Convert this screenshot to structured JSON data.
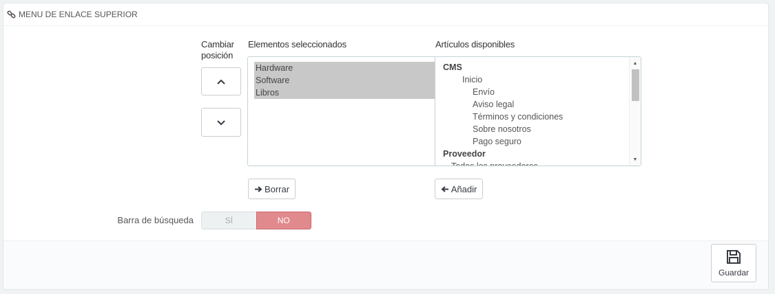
{
  "panel": {
    "title": "MENU DE ENLACE SUPERIOR",
    "title_icon": "link-icon"
  },
  "position": {
    "label_line1": "Cambiar",
    "label_line2": "posición",
    "up_icon": "chevron-up-icon",
    "down_icon": "chevron-down-icon"
  },
  "selected": {
    "label": "Elementos seleccionados",
    "items": [
      "Hardware",
      "Software",
      "Libros"
    ],
    "remove_label": "Borrar",
    "remove_icon": "arrow-right-icon"
  },
  "available": {
    "label": "Artículos disponibles",
    "items": [
      {
        "text": "CMS",
        "level": 0,
        "group": true
      },
      {
        "text": "Inicio",
        "level": 1,
        "group": false
      },
      {
        "text": "Envío",
        "level": 2,
        "group": false
      },
      {
        "text": "Aviso legal",
        "level": 2,
        "group": false
      },
      {
        "text": "Términos y condiciones",
        "level": 2,
        "group": false
      },
      {
        "text": "Sobre nosotros",
        "level": 2,
        "group": false
      },
      {
        "text": "Pago seguro",
        "level": 2,
        "group": false
      },
      {
        "text": "Proveedor",
        "level": 0,
        "group": true
      },
      {
        "text": "Todos los proveedores",
        "level": 1,
        "group": false
      }
    ],
    "add_label": "Añadir",
    "add_icon": "arrow-left-icon"
  },
  "search_bar": {
    "label": "Barra de búsqueda",
    "yes": "SÍ",
    "no": "NO",
    "value": "NO",
    "on_color": "#e08a8e"
  },
  "footer": {
    "save_label": "Guardar",
    "save_icon": "floppy-disk-icon"
  }
}
